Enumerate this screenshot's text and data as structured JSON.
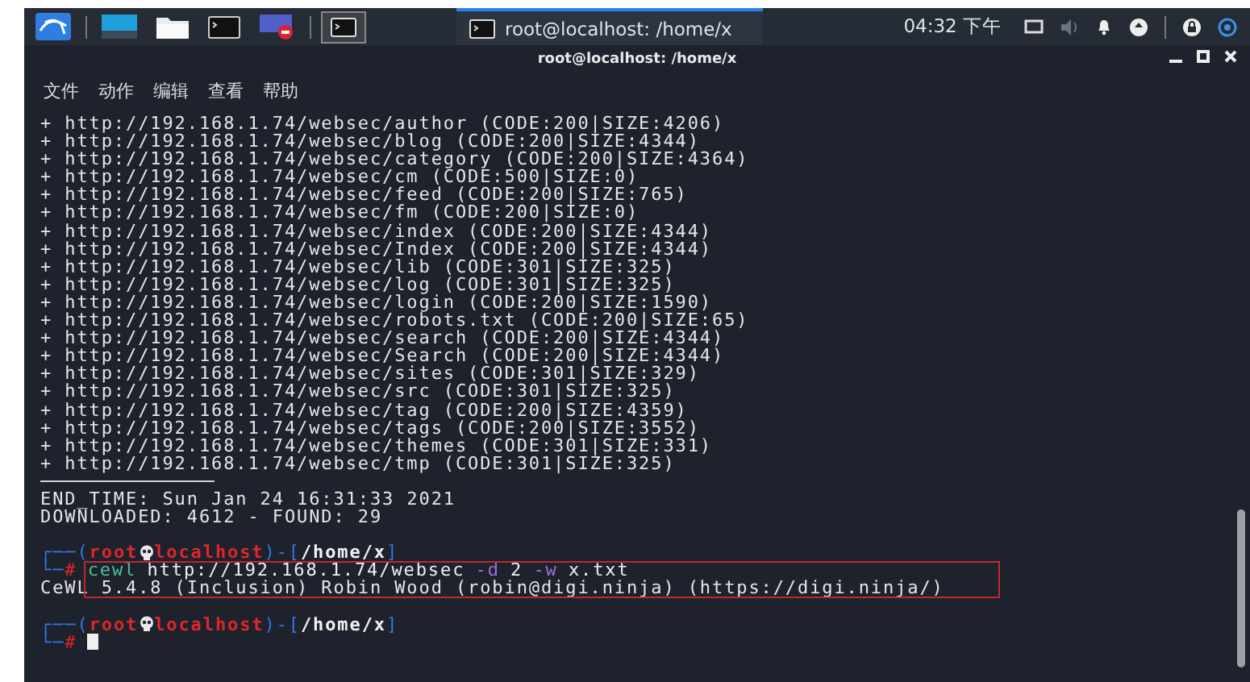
{
  "taskbar": {
    "task": {
      "title": "root@localhost: /home/x",
      "selected": true
    },
    "clock": "04:32 下午"
  },
  "window": {
    "title": "root@localhost: /home/x"
  },
  "menu": [
    "文件",
    "动作",
    "编辑",
    "查看",
    "帮助"
  ],
  "terminal": {
    "output_lines": [
      "+ http://192.168.1.74/websec/author (CODE:200|SIZE:4206)",
      "+ http://192.168.1.74/websec/blog (CODE:200|SIZE:4344)",
      "+ http://192.168.1.74/websec/category (CODE:200|SIZE:4364)",
      "+ http://192.168.1.74/websec/cm (CODE:500|SIZE:0)",
      "+ http://192.168.1.74/websec/feed (CODE:200|SIZE:765)",
      "+ http://192.168.1.74/websec/fm (CODE:200|SIZE:0)",
      "+ http://192.168.1.74/websec/index (CODE:200|SIZE:4344)",
      "+ http://192.168.1.74/websec/Index (CODE:200|SIZE:4344)",
      "+ http://192.168.1.74/websec/lib (CODE:301|SIZE:325)",
      "+ http://192.168.1.74/websec/log (CODE:301|SIZE:325)",
      "+ http://192.168.1.74/websec/login (CODE:200|SIZE:1590)",
      "+ http://192.168.1.74/websec/robots.txt (CODE:200|SIZE:65)",
      "+ http://192.168.1.74/websec/search (CODE:200|SIZE:4344)",
      "+ http://192.168.1.74/websec/Search (CODE:200|SIZE:4344)",
      "+ http://192.168.1.74/websec/sites (CODE:301|SIZE:329)",
      "+ http://192.168.1.74/websec/src (CODE:301|SIZE:325)",
      "+ http://192.168.1.74/websec/tag (CODE:200|SIZE:4359)",
      "+ http://192.168.1.74/websec/tags (CODE:200|SIZE:3552)",
      "+ http://192.168.1.74/websec/themes (CODE:301|SIZE:331)",
      "+ http://192.168.1.74/websec/tmp (CODE:301|SIZE:325)"
    ],
    "summary_lines": [
      "END_TIME: Sun Jan 24 16:31:33 2021",
      "DOWNLOADED: 4612 - FOUND: 29"
    ],
    "sessions": [
      {
        "prompt": [
          {
            "kind": "frame",
            "text": "┌──("
          },
          {
            "kind": "user",
            "text": "root"
          },
          {
            "kind": "skull"
          },
          {
            "kind": "host",
            "text": "localhost"
          },
          {
            "kind": "frame",
            "text": ")-["
          },
          {
            "kind": "path",
            "text": "/home/x"
          },
          {
            "kind": "frame",
            "text": "]"
          }
        ],
        "input": [
          {
            "kind": "frame",
            "text": "└─"
          },
          {
            "kind": "hash",
            "text": "#"
          },
          {
            "kind": "command",
            "text": "cewl"
          },
          {
            "kind": "arg",
            "text": "http://192.168.1.74/websec"
          },
          {
            "kind": "flag",
            "text": "-d"
          },
          {
            "kind": "arg",
            "text": "2"
          },
          {
            "kind": "flag",
            "text": "-w"
          },
          {
            "kind": "arg",
            "text": "x.txt"
          }
        ],
        "output": [
          "CeWL 5.4.8 (Inclusion) Robin Wood (robin@digi.ninja) (https://digi.ninja/)"
        ],
        "highlighted": true,
        "cursor": false
      },
      {
        "prompt": [
          {
            "kind": "frame",
            "text": "┌──("
          },
          {
            "kind": "user",
            "text": "root"
          },
          {
            "kind": "skull"
          },
          {
            "kind": "host",
            "text": "localhost"
          },
          {
            "kind": "frame",
            "text": ")-["
          },
          {
            "kind": "path",
            "text": "/home/x"
          },
          {
            "kind": "frame",
            "text": "]"
          }
        ],
        "input": [
          {
            "kind": "frame",
            "text": "└─"
          },
          {
            "kind": "hash",
            "text": "#"
          }
        ],
        "highlighted": false,
        "cursor": true
      }
    ]
  }
}
